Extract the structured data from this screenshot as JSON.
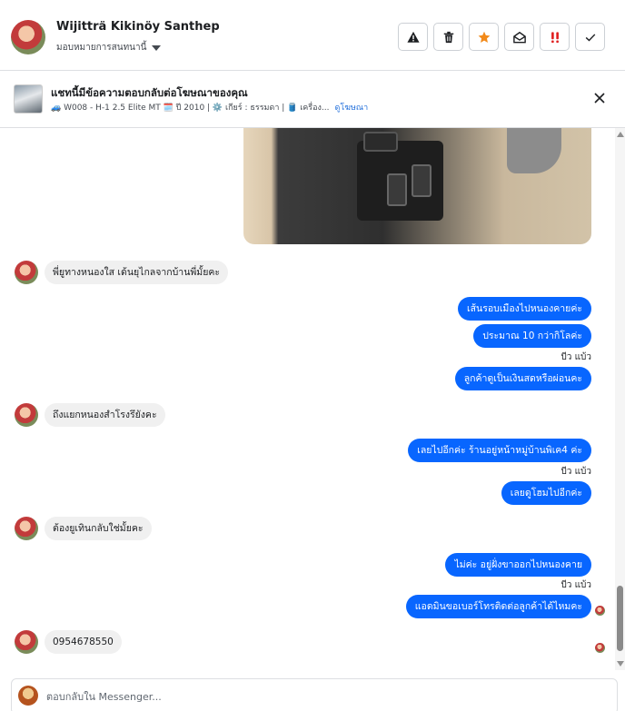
{
  "header": {
    "user_name": "Wĳitträ Kikinöy Santhep",
    "assign_label": "มอบหมายการสนทนานี้",
    "actions": [
      {
        "icon": "warning-icon",
        "color": "#1c1e21"
      },
      {
        "icon": "trash-icon",
        "color": "#1c1e21"
      },
      {
        "icon": "star-icon",
        "color": "#f28a1a"
      },
      {
        "icon": "envelope-open-icon",
        "color": "#1c1e21"
      },
      {
        "icon": "important-icon",
        "color": "#e02020"
      },
      {
        "icon": "check-icon",
        "color": "#1c1e21"
      }
    ]
  },
  "ad": {
    "title": "แชทนี้มีข้อความตอบกลับต่อโฆษณาของคุณ",
    "description": "🚙 W008 - H-1 2.5 Elite MT 🗓️ ปี 2010 | ⚙️ เกียร์ : ธรรมดา | 🛢️ เครื่อง...",
    "link_label": "ดูโฆษณา"
  },
  "messages": {
    "in_1": "พี่ยูทางหนองใส เด้นยุไกลจากบ้านพี่มั้ยคะ",
    "out_1": "เส้นรอบเมืองไปหนองคายค่ะ",
    "out_2": "ประมาณ 10 กว่ากิโลค่ะ",
    "seen_1": "บีว แบ้ว",
    "out_3": "ลูกค้าดูเป็นเงินสดหรือผ่อนคะ",
    "in_2": "ถึงแยกหนองสำโรงรึยังคะ",
    "out_4": "เลยไปอีกค่ะ  ร้านอยู่หน้าหมู่บ้านพิเค4 ค่ะ",
    "seen_2": "บีว แบ้ว",
    "out_5": "เลยดูโฮมไปอีกค่ะ",
    "in_3": "ต้องยูเทินกลับใช่มั้ยคะ",
    "out_6": "ไม่ค่ะ  อยู่ฝั่งขาออกไปหนองคาย",
    "seen_3": "บีว แบ้ว",
    "out_7": "แอดมินขอเบอร์โทรติดต่อลูกค้าได้ไหมคะ",
    "in_4": "0954678550"
  },
  "composer": {
    "placeholder": "ตอบกลับใน Messenger..."
  },
  "colors": {
    "outgoing_bubble": "#0866ff",
    "incoming_bubble": "#f0f0f0",
    "link": "#216fdb"
  }
}
